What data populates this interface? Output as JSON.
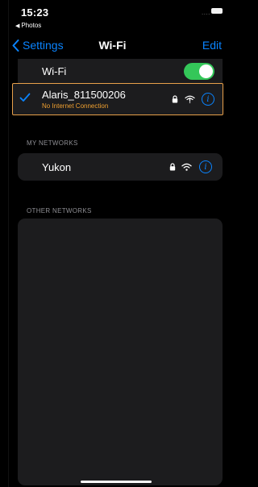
{
  "status_bar": {
    "time": "15:23",
    "back_app": "Photos",
    "signal": "....",
    "battery_color": "#f2f2f2"
  },
  "nav": {
    "back_label": "Settings",
    "title": "Wi-Fi",
    "edit_label": "Edit"
  },
  "wifi_toggle": {
    "label": "Wi-Fi",
    "on": true,
    "color": "#34c759"
  },
  "connected_network": {
    "name": "Alaris_811500206",
    "status": "No Internet Connection",
    "status_color": "#f0a030",
    "icons": [
      "lock-icon",
      "wifi-no-internet-icon",
      "info-icon"
    ]
  },
  "my_networks": {
    "header": "MY NETWORKS",
    "items": [
      {
        "name": "Yukon",
        "icons": [
          "lock-icon",
          "wifi-icon",
          "info-icon"
        ]
      }
    ]
  },
  "other_networks": {
    "header": "OTHER NETWORKS",
    "items": []
  },
  "accent_color": "#0a84ff"
}
